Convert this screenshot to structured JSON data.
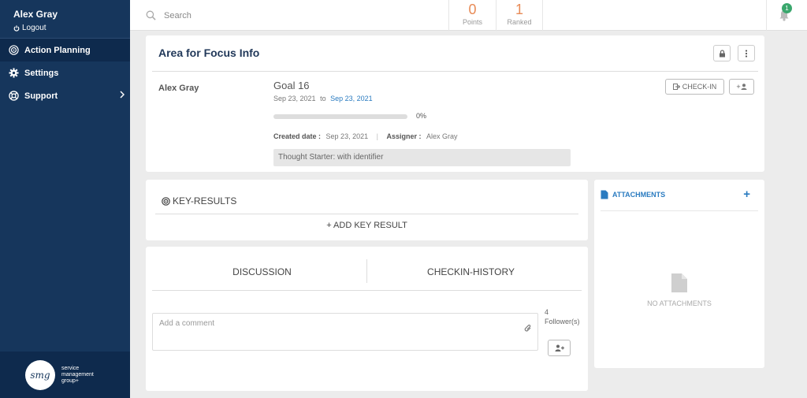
{
  "sidebar": {
    "user_name": "Alex Gray",
    "logout_label": "Logout",
    "items": [
      {
        "label": "Action Planning",
        "icon": "target-icon",
        "active": true
      },
      {
        "label": "Settings",
        "icon": "gear-icon"
      },
      {
        "label": "Support",
        "icon": "lifebuoy-icon"
      }
    ],
    "footer": {
      "logo_text": "smg",
      "brand": "service management group+"
    }
  },
  "topbar": {
    "search_placeholder": "Search",
    "points_value": "0",
    "points_label": "Points",
    "ranked_value": "1",
    "ranked_label": "Ranked",
    "notification_count": "1"
  },
  "focus": {
    "title": "Area for Focus Info",
    "owner": "Alex Gray",
    "goal_title": "Goal 16",
    "start_date": "Sep 23, 2021",
    "to_label": "to",
    "end_date": "Sep 23, 2021",
    "progress_percent_label": "0%",
    "progress_fraction": 0,
    "created_label": "Created date :",
    "created_value": "Sep 23, 2021",
    "assigner_label": "Assigner :",
    "assigner_value": "Alex Gray",
    "thought_starter": "Thought Starter: with identifier",
    "checkin_label": "CHECK-IN",
    "add_user_label": "+"
  },
  "key_results": {
    "title": "KEY-RESULTS",
    "add_label": "+ ADD KEY RESULT"
  },
  "discussion": {
    "tab_discussion": "DISCUSSION",
    "tab_history": "CHECKIN-HISTORY",
    "comment_placeholder": "Add a comment",
    "followers_count": "4",
    "followers_label": "Follower(s)"
  },
  "attachments": {
    "title": "ATTACHMENTS",
    "add_label": "+",
    "empty_label": "NO ATTACHMENTS"
  },
  "colors": {
    "sidebar": "#16365c",
    "accent": "#2a7bc0",
    "points": "#e88b57",
    "badge": "#3aa76d"
  }
}
